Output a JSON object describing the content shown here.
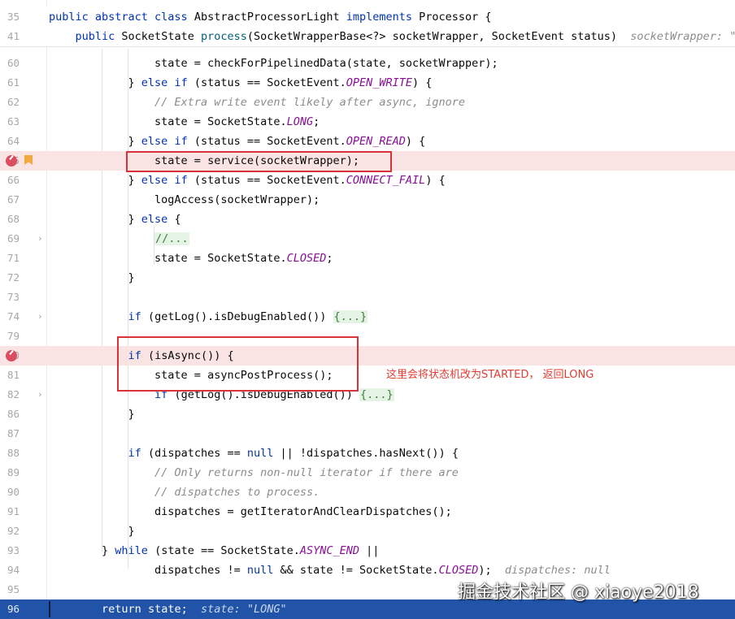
{
  "sticky": [
    {
      "ln": "35",
      "parts": [
        {
          "t": "public abstract class ",
          "c": "kw"
        },
        {
          "t": "AbstractProcessorLight "
        },
        {
          "t": "implements ",
          "c": "kw"
        },
        {
          "t": "Processor {"
        }
      ]
    },
    {
      "ln": "41",
      "parts": [
        {
          "t": "    "
        },
        {
          "t": "public ",
          "c": "kw"
        },
        {
          "t": "SocketState "
        },
        {
          "t": "process",
          "c": "fn"
        },
        {
          "t": "(SocketWrapperBase<?> socketWrapper, SocketEvent status)  "
        },
        {
          "t": "socketWrapper: \"o",
          "c": "hint"
        }
      ]
    }
  ],
  "lines": [
    {
      "ln": "60",
      "parts": [
        {
          "t": "                state = checkForPipelinedData(state, socketWrapper);"
        }
      ]
    },
    {
      "ln": "61",
      "parts": [
        {
          "t": "            } "
        },
        {
          "t": "else if ",
          "c": "kw"
        },
        {
          "t": "(status == SocketEvent."
        },
        {
          "t": "OPEN_WRITE",
          "c": "cst"
        },
        {
          "t": ") {"
        }
      ]
    },
    {
      "ln": "62",
      "parts": [
        {
          "t": "                "
        },
        {
          "t": "// Extra write event likely after async, ignore",
          "c": "cmt"
        }
      ]
    },
    {
      "ln": "63",
      "parts": [
        {
          "t": "                state = SocketState."
        },
        {
          "t": "LONG",
          "c": "cst"
        },
        {
          "t": ";"
        }
      ]
    },
    {
      "ln": "64",
      "parts": [
        {
          "t": "            } "
        },
        {
          "t": "else if ",
          "c": "kw"
        },
        {
          "t": "(status == SocketEvent."
        },
        {
          "t": "OPEN_READ",
          "c": "cst"
        },
        {
          "t": ") {"
        }
      ]
    },
    {
      "ln": "65",
      "bp": true,
      "bm": true,
      "hl": true,
      "parts": [
        {
          "t": "                state = service(socketWrapper);"
        }
      ]
    },
    {
      "ln": "66",
      "parts": [
        {
          "t": "            } "
        },
        {
          "t": "else if ",
          "c": "kw"
        },
        {
          "t": "(status == SocketEvent."
        },
        {
          "t": "CONNECT_FAIL",
          "c": "cst"
        },
        {
          "t": ") {"
        }
      ]
    },
    {
      "ln": "67",
      "parts": [
        {
          "t": "                logAccess(socketWrapper);"
        }
      ]
    },
    {
      "ln": "68",
      "parts": [
        {
          "t": "            } "
        },
        {
          "t": "else ",
          "c": "kw"
        },
        {
          "t": "{"
        }
      ]
    },
    {
      "ln": "69",
      "chev": true,
      "parts": [
        {
          "t": "                "
        },
        {
          "t": "//...",
          "c": "fold"
        }
      ]
    },
    {
      "ln": "71",
      "parts": [
        {
          "t": "                state = SocketState."
        },
        {
          "t": "CLOSED",
          "c": "cst"
        },
        {
          "t": ";"
        }
      ]
    },
    {
      "ln": "72",
      "parts": [
        {
          "t": "            }"
        }
      ]
    },
    {
      "ln": "73",
      "parts": [
        {
          "t": ""
        }
      ]
    },
    {
      "ln": "74",
      "chev": true,
      "parts": [
        {
          "t": "            "
        },
        {
          "t": "if ",
          "c": "kw"
        },
        {
          "t": "(getLog().isDebugEnabled()) "
        },
        {
          "t": "{...}",
          "c": "fold"
        }
      ]
    },
    {
      "ln": "79",
      "parts": [
        {
          "t": ""
        }
      ]
    },
    {
      "ln": "80",
      "bp": true,
      "hl": true,
      "parts": [
        {
          "t": "            "
        },
        {
          "t": "if ",
          "c": "kw"
        },
        {
          "t": "(isAsync()) {"
        }
      ]
    },
    {
      "ln": "81",
      "parts": [
        {
          "t": "                state = asyncPostProcess();"
        }
      ]
    },
    {
      "ln": "82",
      "chev": true,
      "parts": [
        {
          "t": "                "
        },
        {
          "t": "if ",
          "c": "kw"
        },
        {
          "t": "(getLog().isDebugEnabled()) "
        },
        {
          "t": "{...}",
          "c": "fold"
        }
      ]
    },
    {
      "ln": "86",
      "parts": [
        {
          "t": "            }"
        }
      ]
    },
    {
      "ln": "87",
      "parts": [
        {
          "t": ""
        }
      ]
    },
    {
      "ln": "88",
      "parts": [
        {
          "t": "            "
        },
        {
          "t": "if ",
          "c": "kw"
        },
        {
          "t": "(dispatches == "
        },
        {
          "t": "null ",
          "c": "kw"
        },
        {
          "t": "|| !dispatches.hasNext()) {"
        }
      ]
    },
    {
      "ln": "89",
      "parts": [
        {
          "t": "                "
        },
        {
          "t": "// Only returns non-null iterator if there are",
          "c": "cmt"
        }
      ]
    },
    {
      "ln": "90",
      "parts": [
        {
          "t": "                "
        },
        {
          "t": "// dispatches to process.",
          "c": "cmt"
        }
      ]
    },
    {
      "ln": "91",
      "parts": [
        {
          "t": "                dispatches = getIteratorAndClearDispatches();"
        }
      ]
    },
    {
      "ln": "92",
      "parts": [
        {
          "t": "            }"
        }
      ]
    },
    {
      "ln": "93",
      "parts": [
        {
          "t": "        } "
        },
        {
          "t": "while ",
          "c": "kw"
        },
        {
          "t": "(state == SocketState."
        },
        {
          "t": "ASYNC_END ",
          "c": "cst"
        },
        {
          "t": "||"
        }
      ]
    },
    {
      "ln": "94",
      "parts": [
        {
          "t": "                dispatches != "
        },
        {
          "t": "null ",
          "c": "kw"
        },
        {
          "t": "&& state != SocketState."
        },
        {
          "t": "CLOSED",
          "c": "cst"
        },
        {
          "t": ");  "
        },
        {
          "t": "dispatches: null",
          "c": "hint"
        }
      ]
    },
    {
      "ln": "95",
      "parts": [
        {
          "t": ""
        }
      ]
    },
    {
      "ln": "96",
      "cur": true,
      "parts": [
        {
          "t": "        "
        },
        {
          "t": "return ",
          "c": "kw"
        },
        {
          "t": "state;  "
        },
        {
          "t": "state: \"LONG\"",
          "c": "hint"
        }
      ]
    }
  ],
  "annotation": "这里会将状态机改为STARTED， 返回LONG",
  "watermark": "掘金技术社区 @ xiaoye2018",
  "colors": {
    "highlight": "#fae3e3",
    "execution_line": "#2154a9",
    "breakpoint": "#db4d60",
    "annotation": "#e53a30",
    "bookmark": "#f2a93b"
  }
}
